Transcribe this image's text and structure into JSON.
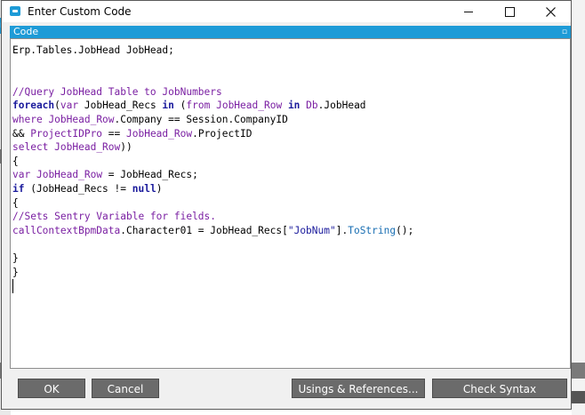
{
  "window": {
    "title": "Enter Custom Code"
  },
  "background": {
    "left_tab_top": "m",
    "left_tab_mid": "e 2"
  },
  "panel": {
    "header_label": "Code"
  },
  "code": {
    "lines": [
      [
        {
          "t": "Erp.Tables.JobHead JobHead;",
          "c": ""
        }
      ],
      [],
      [],
      [
        {
          "t": "//Query JobHead Table to JobNumbers",
          "c": "cm"
        }
      ],
      [
        {
          "t": "foreach",
          "c": "kw"
        },
        {
          "t": "(",
          "c": ""
        },
        {
          "t": "var",
          "c": "kw2"
        },
        {
          "t": " JobHead_Recs ",
          "c": ""
        },
        {
          "t": "in",
          "c": "kw"
        },
        {
          "t": " (",
          "c": ""
        },
        {
          "t": "from",
          "c": "kw2"
        },
        {
          "t": " ",
          "c": ""
        },
        {
          "t": "JobHead_Row",
          "c": "id"
        },
        {
          "t": " ",
          "c": ""
        },
        {
          "t": "in",
          "c": "kw"
        },
        {
          "t": " ",
          "c": ""
        },
        {
          "t": "Db",
          "c": "id"
        },
        {
          "t": ".JobHead",
          "c": ""
        }
      ],
      [
        {
          "t": "where",
          "c": "kw2"
        },
        {
          "t": " ",
          "c": ""
        },
        {
          "t": "JobHead_Row",
          "c": "id"
        },
        {
          "t": ".Company == Session.CompanyID",
          "c": ""
        }
      ],
      [
        {
          "t": "&& ",
          "c": ""
        },
        {
          "t": "ProjectIDPro",
          "c": "id"
        },
        {
          "t": " == ",
          "c": ""
        },
        {
          "t": "JobHead_Row",
          "c": "id"
        },
        {
          "t": ".ProjectID",
          "c": ""
        }
      ],
      [
        {
          "t": "select",
          "c": "kw2"
        },
        {
          "t": " ",
          "c": ""
        },
        {
          "t": "JobHead_Row",
          "c": "id"
        },
        {
          "t": "))",
          "c": ""
        }
      ],
      [
        {
          "t": "{",
          "c": ""
        }
      ],
      [
        {
          "t": "var",
          "c": "kw2"
        },
        {
          "t": " ",
          "c": ""
        },
        {
          "t": "JobHead_Row",
          "c": "id"
        },
        {
          "t": " = JobHead_Recs;",
          "c": ""
        }
      ],
      [
        {
          "t": "if",
          "c": "kw"
        },
        {
          "t": " (JobHead_Recs != ",
          "c": ""
        },
        {
          "t": "null",
          "c": "kw"
        },
        {
          "t": ")",
          "c": ""
        }
      ],
      [
        {
          "t": "{",
          "c": ""
        }
      ],
      [
        {
          "t": "//Sets Sentry Variable for fields.",
          "c": "cm"
        }
      ],
      [
        {
          "t": "callContextBpmData",
          "c": "id"
        },
        {
          "t": ".Character01 = JobHead_Recs[",
          "c": ""
        },
        {
          "t": "\"JobNum\"",
          "c": "str"
        },
        {
          "t": "].",
          "c": ""
        },
        {
          "t": "ToString",
          "c": "meth"
        },
        {
          "t": "();",
          "c": ""
        }
      ],
      [],
      [
        {
          "t": "}",
          "c": ""
        }
      ],
      [
        {
          "t": "}",
          "c": ""
        }
      ]
    ]
  },
  "buttons": {
    "ok": "OK",
    "cancel": "Cancel",
    "usings": "Usings & References...",
    "check_syntax": "Check Syntax"
  },
  "colors": {
    "accent": "#1e9bd7",
    "button_bg": "#6b6b6b",
    "keyword": "#1a1a9c",
    "identifier": "#7a1fa2"
  }
}
